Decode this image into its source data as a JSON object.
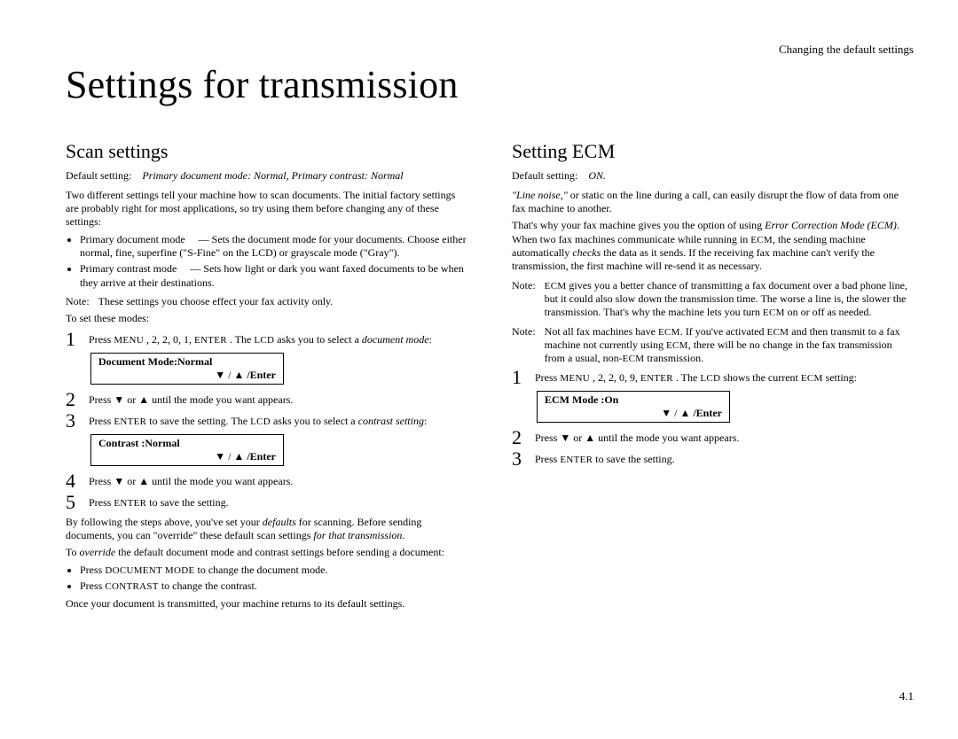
{
  "running_head": "Changing the default settings",
  "page_title": "Settings for transmission",
  "footer_page": "4.1",
  "left": {
    "heading": "Scan settings",
    "default_label": "Default setting:",
    "default_value": "Primary document mode: Normal, Primary contrast: Normal",
    "intro": "Two different settings tell your machine how to scan documents. The initial factory settings are probably right for most applications, so try using them before changing any of these settings:",
    "bullets": [
      {
        "key": "Primary document mode",
        "desc": "— Sets the document mode for your documents. Choose either normal, fine, superfine (\"S-Fine\" on the LCD) or grayscale mode (\"Gray\")."
      },
      {
        "key": "Primary contrast mode",
        "desc": "— Sets how light or dark you want faxed documents to be when they arrive at their destinations."
      }
    ],
    "note1_label": "Note:",
    "note1_body": "These settings you choose effect your fax activity only.",
    "set_modes_intro": "To set these modes:",
    "step1_a": "Press ",
    "step1_menu": "MENU",
    "step1_b": " , 2, 2, 0, 1, ",
    "step1_enter": "ENTER",
    "step1_c": " . The ",
    "step1_lcd": "LCD",
    "step1_d": " asks you to select a ",
    "step1_e": "document mode",
    "step1_f": ":",
    "lcd1_line1": "Document Mode:Normal",
    "lcd1_line2_arrows": "▼  / ▲",
    "lcd1_line2_enter": "/Enter",
    "step2": "Press ▼ or ▲ until the mode you want appears.",
    "step3_a": "Press ",
    "step3_enter": "ENTER",
    "step3_b": "  to save the setting. The ",
    "step3_lcd": "LCD",
    "step3_c": " asks you to select a ",
    "step3_d": "contrast setting",
    "step3_e": ":",
    "lcd2_line1": "Contrast    :Normal",
    "lcd2_line2_arrows": "▼  / ▲",
    "lcd2_line2_enter": "/Enter",
    "step4": "Press ▼ or ▲ until the mode you want appears.",
    "step5_a": "Press ",
    "step5_enter": "ENTER",
    "step5_b": "  to save the setting.",
    "override_p1_a": "By following the steps above, you've set your ",
    "override_p1_b": "defaults",
    "override_p1_c": " for scanning. Before sending documents, you can \"override\" these default scan settings ",
    "override_p1_d": "for that transmission",
    "override_p1_e": ".",
    "override_p2_a": "To ",
    "override_p2_b": "override",
    "override_p2_c": " the default document mode and contrast settings before sending a document:",
    "override_b1_a": "Press ",
    "override_b1_kbd": "DOCUMENT MODE",
    "override_b1_b": "  to change the document mode.",
    "override_b2_a": "Press ",
    "override_b2_kbd": "CONTRAST",
    "override_b2_b": "  to change the contrast.",
    "final": "Once your document is transmitted, your machine returns to its default settings."
  },
  "right": {
    "heading_a": "Setting ",
    "heading_b": "ECM",
    "default_label": "Default setting:",
    "default_value": "ON.",
    "p1_a": "\"Line noise,\"",
    "p1_b": " or static on the line during a call, can easily disrupt the flow of data from one fax machine to another.",
    "p2_a": "That's why your fax machine gives you the option of using ",
    "p2_b": "Error Correction Mode (ECM)",
    "p2_c": ". When two fax machines communicate while running in ",
    "p2_ecm1": "ECM",
    "p2_d": ", the sending machine automatically ",
    "p2_e": "checks",
    "p2_f": " the data as it sends. If the receiving fax machine can't verify the transmission, the first machine will re-send it as necessary.",
    "note1_label": "Note:",
    "note1_a": "ECM",
    "note1_b": " gives you a better chance of transmitting a fax document over a bad phone line, but it could also slow down the transmission time. The worse a line is, the slower the transmission. That's why the machine lets you turn ",
    "note1_c": "ECM",
    "note1_d": " on or off as needed.",
    "note2_label": "Note:",
    "note2_a": "Not all fax machines have ",
    "note2_b": "ECM",
    "note2_c": ". If you've activated ",
    "note2_d": "ECM",
    "note2_e": " and then transmit to a fax machine not currently using ",
    "note2_f": "ECM",
    "note2_g": ", there will be no change in the fax transmission from a usual, non-",
    "note2_h": "ECM",
    "note2_i": " transmission.",
    "step1_a": "Press ",
    "step1_menu": "MENU",
    "step1_b": " , 2, 2, 0, 9, ",
    "step1_enter": "ENTER",
    "step1_c": " . The ",
    "step1_lcd": "LCD",
    "step1_d": " shows the current ",
    "step1_ecm": "ECM",
    "step1_e": " setting:",
    "lcd_line1": "ECM  Mode       :On",
    "lcd_line2_arrows": "▼  / ▲",
    "lcd_line2_enter": "/Enter",
    "step2": "Press ▼ or ▲ until the mode you want appears.",
    "step3_a": "Press ",
    "step3_enter": "ENTER",
    "step3_b": "  to save the setting."
  }
}
